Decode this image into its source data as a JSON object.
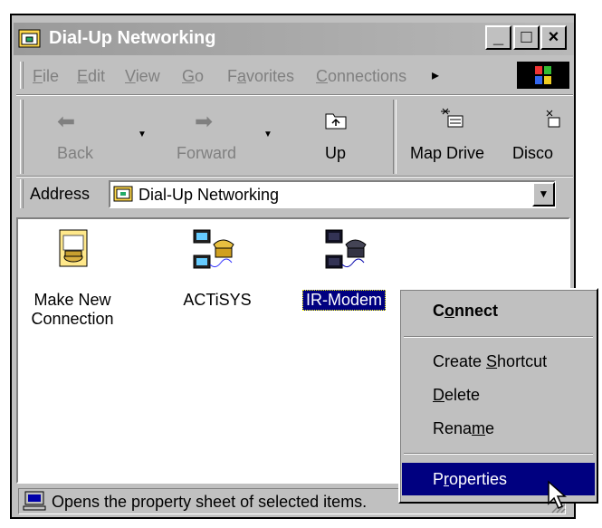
{
  "window": {
    "title": "Dial-Up Networking"
  },
  "title_buttons": {
    "minimize": "_",
    "maximize": "□",
    "close": "×"
  },
  "menubar": {
    "items": [
      {
        "pre": "",
        "u": "F",
        "post": "ile"
      },
      {
        "pre": "",
        "u": "E",
        "post": "dit"
      },
      {
        "pre": "",
        "u": "V",
        "post": "iew"
      },
      {
        "pre": "",
        "u": "G",
        "post": "o"
      },
      {
        "pre": "F",
        "u": "a",
        "post": "vorites"
      },
      {
        "pre": "",
        "u": "C",
        "post": "onnections"
      }
    ],
    "overflow_arrow": "▸"
  },
  "toolbar": {
    "back": "Back",
    "forward": "Forward",
    "up": "Up",
    "map_drive": "Map Drive",
    "disconnect": "Disco"
  },
  "address": {
    "label": "Address",
    "value": "Dial-Up Networking"
  },
  "items": [
    {
      "label1": "Make New",
      "label2": "Connection"
    },
    {
      "label1": "ACTiSYS",
      "label2": ""
    },
    {
      "label1": "IR-Modem",
      "label2": ""
    }
  ],
  "status": {
    "text": "Opens the property sheet of selected items."
  },
  "context_menu": {
    "connect": {
      "pre": "C",
      "u": "o",
      "post": "nnect"
    },
    "create_shortcut": {
      "pre": "Create ",
      "u": "S",
      "post": "hortcut"
    },
    "delete": {
      "pre": "",
      "u": "D",
      "post": "elete"
    },
    "rename": {
      "pre": "Rena",
      "u": "m",
      "post": "e"
    },
    "properties": {
      "pre": "P",
      "u": "r",
      "post": "operties"
    }
  },
  "colors": {
    "selection": "#000080",
    "titlebar": "#a0a0a0",
    "face": "#c0c0c0"
  }
}
